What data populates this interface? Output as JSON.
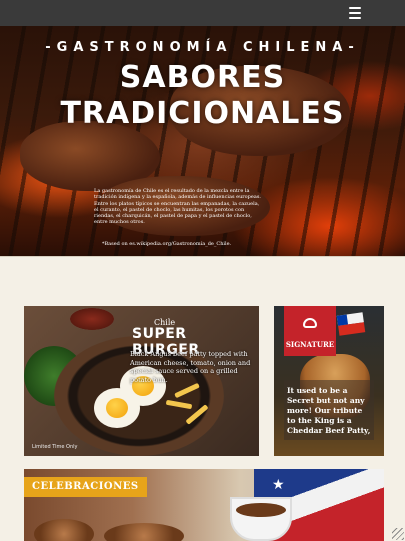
{
  "nav": {
    "menu_icon": "hamburger-menu-icon"
  },
  "hero": {
    "subtitle": "-GASTRONOMÍA CHILENA-",
    "title_line1": "SABORES",
    "title_line2": "TRADICIONALES",
    "description": "La gastronomía de Chile es el resultado de la mezcla entre la tradición indígena y la española, además de influencias europeas. Entre los platos típicos se encuentran las empanadas, la cazuela, el curanto, el pastel de choclo, las humitas, los porotos con riendas, el charquicán, el pastel de papa y el pastel de choclo, entre muchos otros.",
    "source": "*Based on es.wikipedia.org/Gastronomía_de_Chile."
  },
  "cards": {
    "chorrillana": {
      "small_label": "Chile",
      "title": "SUPER BURGER",
      "description": "Black Angus beef patty topped with American cheese, tomato, onion and special sauce served on a grilled potato bun.",
      "footnote": "Limited Time Only"
    },
    "signature": {
      "badge": "SIGNATURE",
      "icon": "burger-icon",
      "description": "It used to be a Secret but not any more! Our tribute to the King is a Cheddar Beef Patty,"
    },
    "celebraciones": {
      "label": "CELEBRACIONES"
    }
  }
}
